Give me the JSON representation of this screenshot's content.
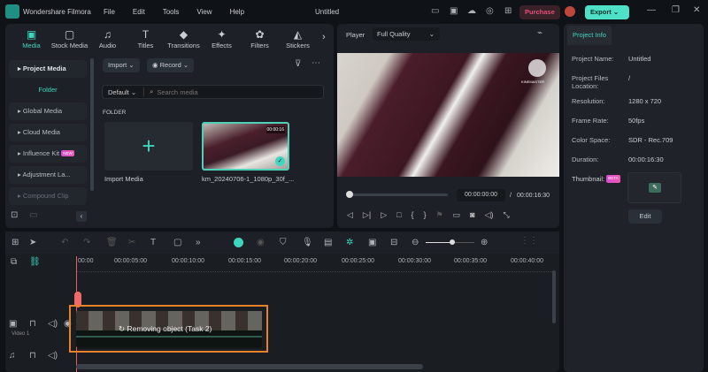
{
  "app": {
    "name": "Wondershare Filmora",
    "title": "Untitled",
    "menu": [
      "File",
      "Edit",
      "Tools",
      "View",
      "Help"
    ],
    "purchase": "Purchase",
    "export": "Export"
  },
  "tabs": [
    {
      "label": "Media",
      "icon": "media-icon"
    },
    {
      "label": "Stock Media",
      "icon": "stock-icon"
    },
    {
      "label": "Audio",
      "icon": "music-icon"
    },
    {
      "label": "Titles",
      "icon": "text-icon"
    },
    {
      "label": "Transitions",
      "icon": "transition-icon"
    },
    {
      "label": "Effects",
      "icon": "effects-icon"
    },
    {
      "label": "Filters",
      "icon": "filters-icon"
    },
    {
      "label": "Stickers",
      "icon": "stickers-icon"
    }
  ],
  "sidebar": {
    "items": [
      "Project Media",
      "Folder",
      "Global Media",
      "Cloud Media",
      "Influence Kit",
      "Adjustment La...",
      "Compound Clip"
    ],
    "new_badge": "NEW"
  },
  "media": {
    "import": "Import",
    "record": "Record",
    "sort": "Default",
    "search_placeholder": "Search media",
    "folder_label": "FOLDER",
    "import_media": "Import Media",
    "clip_name": "km_20240706-1_1080p_30f_...",
    "clip_duration": "00:00:16"
  },
  "player": {
    "label": "Player",
    "quality": "Full Quality",
    "watermark": "KINEMASTER",
    "current": "00:00:00:00",
    "separator": "/",
    "total": "00:00:16:30",
    "progress": 0
  },
  "project_info": {
    "tab": "Project Info",
    "fields": [
      {
        "k": "Project Name:",
        "v": "Untitled"
      },
      {
        "k": "Project Files Location:",
        "v": "/"
      },
      {
        "k": "Resolution:",
        "v": "1280 x 720"
      },
      {
        "k": "Frame Rate:",
        "v": "50fps"
      },
      {
        "k": "Color Space:",
        "v": "SDR - Rec.709"
      },
      {
        "k": "Duration:",
        "v": "00:00:16:30"
      }
    ],
    "thumbnail": "Thumbnail:",
    "beta": "BETA",
    "edit": "Edit"
  },
  "timeline": {
    "ruler": [
      "00:00",
      "00:00:05:00",
      "00:00:10:00",
      "00:00:15:00",
      "00:00:20:00",
      "00:00:25:00",
      "00:00:30:00",
      "00:00:35:00",
      "00:00:40:00"
    ],
    "track_label": "Video 1",
    "clip_status": "Removing object (Task   2)",
    "highlight_color": "#e8812c"
  },
  "colors": {
    "accent": "#3fd6bf",
    "purchase": "#e0507a"
  }
}
